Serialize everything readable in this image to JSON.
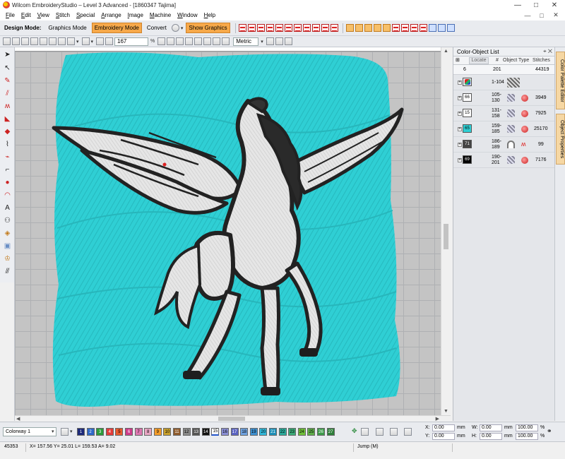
{
  "window": {
    "title": "Wilcom EmbroideryStudio – Level 3 Advanced - [1860347       Tajima]",
    "controls": [
      "—",
      "□",
      "✕"
    ]
  },
  "menu": [
    "File",
    "Edit",
    "View",
    "Stitch",
    "Special",
    "Arrange",
    "Image",
    "Machine",
    "Window",
    "Help"
  ],
  "toolbar": {
    "design_mode_label": "Design Mode:",
    "graphics_mode": "Graphics Mode",
    "embroidery_mode": "Embroidery Mode",
    "convert": "Convert",
    "show_graphics": "Show Graphics",
    "zoom": "167",
    "zoom_unit": "%",
    "units": "Metric"
  },
  "panel": {
    "title": "Color-Object List",
    "locate": "Locate",
    "columns": {
      "num": "#",
      "type": "Object Type",
      "stitches": "Stitches"
    },
    "summary": {
      "count": "6",
      "objects": "201",
      "stitches": "44319"
    },
    "rows": [
      {
        "swatch": "",
        "swatch_color": "#ffffff",
        "range": "1-104",
        "stitches": "",
        "icon": "pattern-icon"
      },
      {
        "swatch": "66",
        "swatch_color": "#ffffff",
        "range": "105-130",
        "stitches": "3949",
        "icon": "tatami-icon"
      },
      {
        "swatch": "15",
        "swatch_color": "#ffffff",
        "range": "131-158",
        "stitches": "7925",
        "icon": "tatami-icon"
      },
      {
        "swatch": "65",
        "swatch_color": "#2fcfd4",
        "range": "159-185",
        "stitches": "25170",
        "icon": "tatami-icon"
      },
      {
        "swatch": "71",
        "swatch_color": "#444444",
        "range": "186-189",
        "stitches": "99",
        "icon": "satin-icon"
      },
      {
        "swatch": "69",
        "swatch_color": "#000000",
        "range": "190-201",
        "stitches": "7176",
        "icon": "tatami-icon"
      }
    ]
  },
  "side_tabs": [
    "Color Palette Editor",
    "Object Properties"
  ],
  "colorway": {
    "name": "Colorway 1",
    "chips": [
      {
        "n": "1",
        "color": "#1d2a7a"
      },
      {
        "n": "2",
        "color": "#2f69c9"
      },
      {
        "n": "3",
        "color": "#2c9c3a"
      },
      {
        "n": "4",
        "color": "#e43b3b"
      },
      {
        "n": "5",
        "color": "#e85a2e"
      },
      {
        "n": "6",
        "color": "#ce3b8a"
      },
      {
        "n": "7",
        "color": "#dc77b0"
      },
      {
        "n": "8",
        "color": "#e7a6c4"
      },
      {
        "n": "9",
        "color": "#f39c2a"
      },
      {
        "n": "10",
        "color": "#c9a12e"
      },
      {
        "n": "11",
        "color": "#8e5b2d"
      },
      {
        "n": "12",
        "color": "#8a8a8a"
      },
      {
        "n": "13",
        "color": "#555555"
      },
      {
        "n": "14",
        "color": "#111111"
      },
      {
        "n": "15",
        "color": "#ffffff"
      },
      {
        "n": "16",
        "color": "#8a8fd6"
      },
      {
        "n": "17",
        "color": "#5a63c2"
      },
      {
        "n": "18",
        "color": "#6fa2e0"
      },
      {
        "n": "19",
        "color": "#3d8fd0"
      },
      {
        "n": "20",
        "color": "#2fb6d9"
      },
      {
        "n": "21",
        "color": "#1d8fb8"
      },
      {
        "n": "22",
        "color": "#2aa99a"
      },
      {
        "n": "23",
        "color": "#3aaa78"
      },
      {
        "n": "24",
        "color": "#6fbf3a"
      },
      {
        "n": "25",
        "color": "#5fae4a"
      },
      {
        "n": "26",
        "color": "#3d9b4a"
      },
      {
        "n": "27",
        "color": "#2f7f3a"
      }
    ]
  },
  "coords": {
    "x_label": "X:",
    "x": "0.00",
    "y_label": "Y:",
    "y": "0.00",
    "w_label": "W:",
    "w": "0.00",
    "h_label": "H:",
    "h": "0.00",
    "unit": "mm",
    "sx": "100.00",
    "sy": "100.00",
    "pct": "%"
  },
  "status": {
    "count": "45353",
    "position": "X= 157.56 Y= 25.01 L= 159.53 A= 9.02",
    "mode": "Jump (M)"
  }
}
